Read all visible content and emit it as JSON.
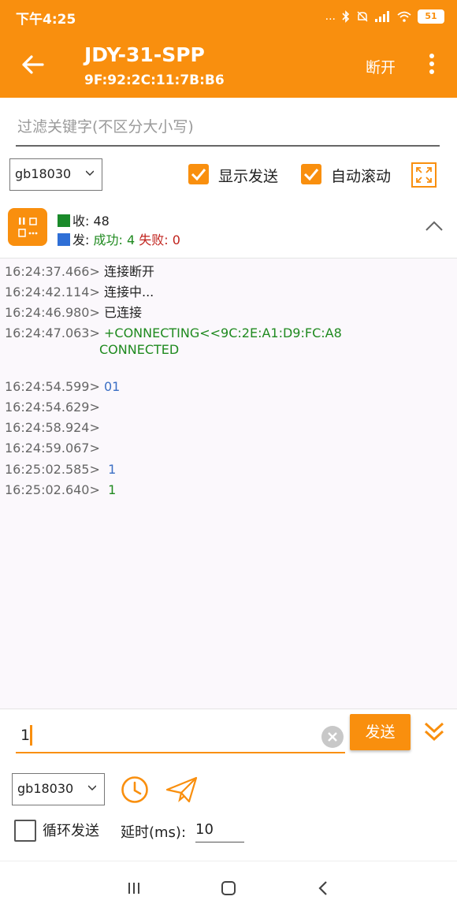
{
  "status_bar": {
    "time": "下午4:25",
    "signal_text": "...",
    "battery": "51"
  },
  "header": {
    "title": "JDY-31-SPP",
    "address": "9F:92:2C:11:7B:B6",
    "disconnect_label": "断开",
    "back_icon": "arrow-left-icon",
    "more_icon": "more-vert-icon"
  },
  "filter": {
    "placeholder": "过滤关键字(不区分大小写)",
    "value": ""
  },
  "toolbar": {
    "encoding": "gb18030",
    "show_send_label": "显示发送",
    "show_send_checked": true,
    "auto_scroll_label": "自动滚动",
    "auto_scroll_checked": true
  },
  "stats": {
    "recv_label": "收: 48",
    "send_prefix": "发: ",
    "success_label": "成功: 4",
    "fail_label": "失败: 0",
    "recv_color": "#1a8a2a",
    "send_color": "#2f6fd6"
  },
  "log": [
    {
      "ts": "16:24:37.466>",
      "msg": "连接断开",
      "color": "#222222"
    },
    {
      "ts": "16:24:42.114>",
      "msg": "连接中...",
      "color": "#222222"
    },
    {
      "ts": "16:24:46.980>",
      "msg": "已连接",
      "color": "#222222"
    },
    {
      "ts": "16:24:47.063>",
      "msg": "+CONNECTING<<9C:2E:A1:D9:FC:A8",
      "msg2": "CONNECTED",
      "color": "#1f8a1f"
    },
    {
      "ts": "16:24:54.599>",
      "msg": "01",
      "color": "#3b6fc4"
    },
    {
      "ts": "16:24:54.629>",
      "msg": "",
      "color": "#222222"
    },
    {
      "ts": "16:24:58.924>",
      "msg": "",
      "color": "#222222"
    },
    {
      "ts": "16:24:59.067>",
      "msg": "",
      "color": "#222222"
    },
    {
      "ts": "16:25:02.585>",
      "msg": " 1",
      "color": "#3b6fc4"
    },
    {
      "ts": "16:25:02.640>",
      "msg": " 1",
      "color": "#1f8a1f"
    }
  ],
  "send": {
    "input_value": "1",
    "send_label": "发送",
    "encoding": "gb18030",
    "loop_label": "循环发送",
    "loop_checked": false,
    "delay_label": "延时(ms):",
    "delay_value": "10"
  },
  "accent_color": "#f98f0e"
}
